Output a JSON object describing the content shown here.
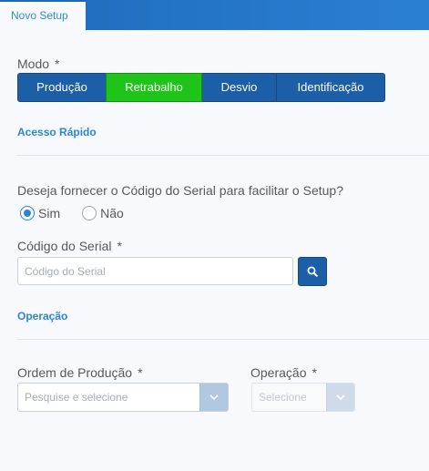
{
  "tabs": [
    {
      "label": "Novo Setup",
      "active": true
    }
  ],
  "modo": {
    "label": "Modo",
    "required_mark": "*",
    "options": [
      "Produção",
      "Retrabalho",
      "Desvio",
      "Identificação"
    ],
    "selected": "Retrabalho"
  },
  "sections": {
    "acesso_rapido": "Acesso Rápido",
    "operacao": "Operação"
  },
  "serial_question": {
    "text": "Deseja fornecer o Código do Serial para facilitar o Setup?",
    "options": [
      "Sim",
      "Não"
    ],
    "selected": "Sim"
  },
  "codigo_serial": {
    "label": "Código do Serial",
    "required_mark": "*",
    "placeholder": "Código do Serial",
    "value": ""
  },
  "ordem_producao": {
    "label": "Ordem de Produção",
    "required_mark": "*",
    "placeholder": "Pesquise e selecione"
  },
  "operacao_select": {
    "label": "Operação",
    "required_mark": "*",
    "placeholder": "Selecione",
    "disabled": true
  },
  "colors": {
    "primary": "#1c5fa6",
    "active_mode": "#1fc41a",
    "section_title": "#2b85d4"
  }
}
